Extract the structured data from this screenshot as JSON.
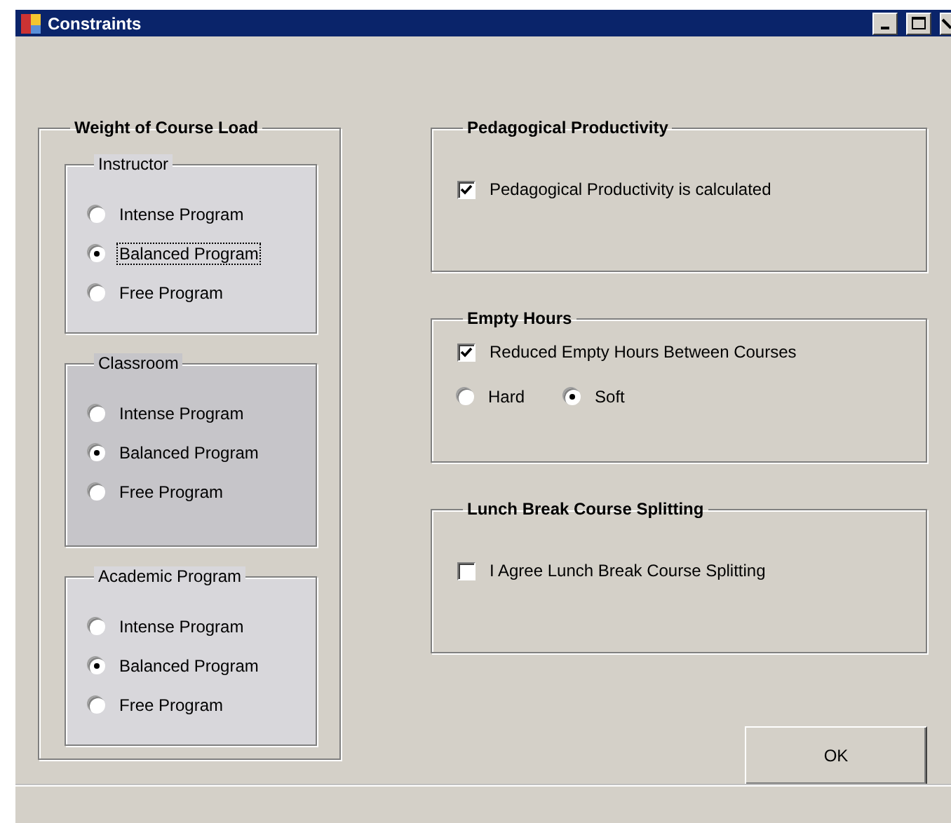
{
  "window": {
    "title": "Constraints"
  },
  "course_load": {
    "title": "Weight of Course Load",
    "groups": [
      {
        "title": "Instructor",
        "shaded": false,
        "options": [
          {
            "label": "Intense Program",
            "selected": false,
            "focused": false
          },
          {
            "label": "Balanced Program",
            "selected": true,
            "focused": true
          },
          {
            "label": "Free Program",
            "selected": false,
            "focused": false
          }
        ]
      },
      {
        "title": "Classroom",
        "shaded": true,
        "options": [
          {
            "label": "Intense Program",
            "selected": false,
            "focused": false
          },
          {
            "label": "Balanced Program",
            "selected": true,
            "focused": false
          },
          {
            "label": "Free Program",
            "selected": false,
            "focused": false
          }
        ]
      },
      {
        "title": "Academic Program",
        "shaded": false,
        "options": [
          {
            "label": "Intense Program",
            "selected": false,
            "focused": false
          },
          {
            "label": "Balanced Program",
            "selected": true,
            "focused": false
          },
          {
            "label": "Free Program",
            "selected": false,
            "focused": false
          }
        ]
      }
    ]
  },
  "sections": [
    {
      "title": "Pedagogical Productivity",
      "rows": [
        {
          "kind": "checkbox",
          "label": "Pedagogical Productivity is calculated",
          "checked": true
        }
      ]
    },
    {
      "title": "Empty Hours",
      "rows": [
        {
          "kind": "checkbox",
          "label": "Reduced Empty Hours Between Courses",
          "checked": true
        },
        {
          "kind": "radios",
          "options": [
            {
              "label": "Hard",
              "selected": false
            },
            {
              "label": "Soft",
              "selected": true
            }
          ]
        }
      ]
    },
    {
      "title": "Lunch Break Course Splitting",
      "rows": [
        {
          "kind": "checkbox",
          "label": "I Agree Lunch Break Course Splitting",
          "checked": false
        }
      ]
    }
  ],
  "ok_button": "OK"
}
